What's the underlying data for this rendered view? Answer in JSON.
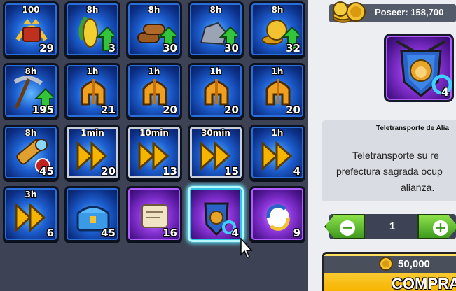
{
  "inventory": {
    "items": [
      {
        "name": "vip-crest",
        "time": "100",
        "count": "29",
        "style": "blue"
      },
      {
        "name": "corn-boost",
        "time": "8h",
        "count": "3",
        "style": "blue"
      },
      {
        "name": "wood-boost",
        "time": "8h",
        "count": "30",
        "style": "blue"
      },
      {
        "name": "stone-boost",
        "time": "8h",
        "count": "30",
        "style": "blue"
      },
      {
        "name": "gold-boost",
        "time": "8h",
        "count": "32",
        "style": "blue"
      },
      {
        "name": "pickaxe-boost",
        "time": "8h",
        "count": "195",
        "style": "blue"
      },
      {
        "name": "helmet-heart",
        "time": "1h",
        "count": "21",
        "style": "blue"
      },
      {
        "name": "helmet-shield",
        "time": "1h",
        "count": "20",
        "style": "blue"
      },
      {
        "name": "helmet-sword",
        "time": "1h",
        "count": "20",
        "style": "blue"
      },
      {
        "name": "helmet-speed",
        "time": "1h",
        "count": "20",
        "style": "blue"
      },
      {
        "name": "spyglass",
        "time": "8h",
        "count": "45",
        "style": "blue"
      },
      {
        "name": "speedup-1min",
        "time": "1min",
        "count": "20",
        "style": "silver"
      },
      {
        "name": "speedup-10min",
        "time": "10min",
        "count": "13",
        "style": "silver"
      },
      {
        "name": "speedup-30min",
        "time": "30min",
        "count": "15",
        "style": "silver"
      },
      {
        "name": "speedup-1h",
        "time": "1h",
        "count": "4",
        "style": "blue"
      },
      {
        "name": "speedup-3h",
        "time": "3h",
        "count": "6",
        "style": "blue"
      },
      {
        "name": "chest",
        "time": "",
        "count": "45",
        "style": "blue"
      },
      {
        "name": "scroll",
        "time": "",
        "count": "16",
        "style": "purple"
      },
      {
        "name": "alliance-teleport",
        "time": "",
        "count": "4",
        "style": "purple"
      },
      {
        "name": "random-teleport",
        "time": "",
        "count": "9",
        "style": "purple"
      }
    ]
  },
  "panel": {
    "owned_label": "Poseer: 158,700",
    "selected_count": "4",
    "item_name": "Teletransporte de Alia",
    "desc_line1": "Teletransporte  su re",
    "desc_line2": "prefectura sagrada ocup",
    "desc_line3": "alianza.",
    "quantity": "1",
    "price": "50,000",
    "buy_label": "COMPRA"
  },
  "colors": {
    "tile_blue": "#1d5fd0",
    "tile_purple": "#8a34d8",
    "selected_glow": "#62e6ff",
    "buy_button": "#f5b400",
    "qty_button": "#5cbf2a"
  }
}
